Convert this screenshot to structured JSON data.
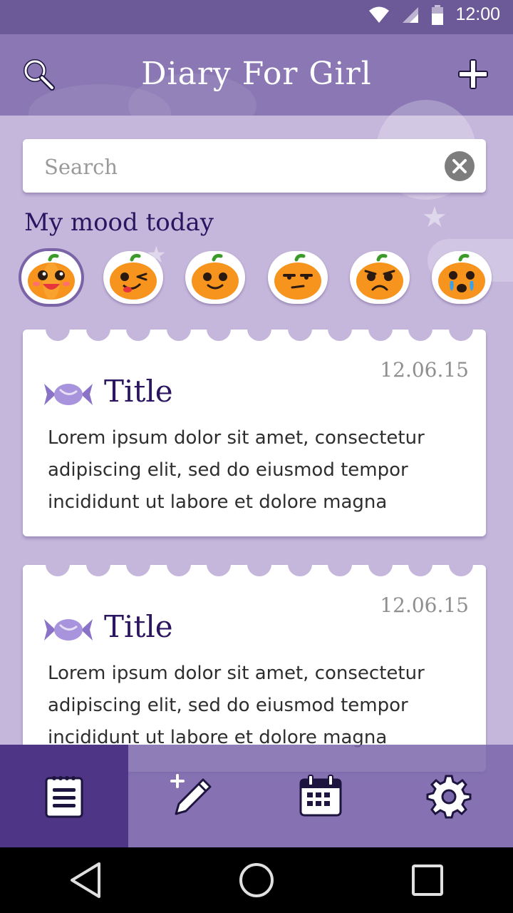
{
  "status_bar": {
    "time": "12:00"
  },
  "header": {
    "title": "Diary For Girl"
  },
  "search": {
    "placeholder": "Search",
    "value": ""
  },
  "mood": {
    "heading": "My mood today",
    "options": [
      "happy-pumpkin-icon",
      "wink-pumpkin-icon",
      "smile-pumpkin-icon",
      "meh-pumpkin-icon",
      "sad-pumpkin-icon",
      "crying-pumpkin-icon"
    ],
    "selected": 0
  },
  "entries": [
    {
      "date": "12.06.15",
      "title": "Title",
      "body": "Lorem ipsum dolor sit amet, consectetur adipiscing elit, sed do eiusmod tempor incididunt ut labore et dolore magna"
    },
    {
      "date": "12.06.15",
      "title": "Title",
      "body": "Lorem ipsum dolor sit amet, consectetur adipiscing elit, sed do eiusmod tempor incididunt ut labore et dolore magna"
    }
  ],
  "bottom_nav": {
    "items": [
      "notebook-icon",
      "new-entry-icon",
      "calendar-icon",
      "settings-icon"
    ],
    "active": 0
  },
  "colors": {
    "accent": "#8a77b4",
    "active_nav": "#4f3585",
    "title_text": "#2b1460",
    "pumpkin": "#f7941d"
  }
}
